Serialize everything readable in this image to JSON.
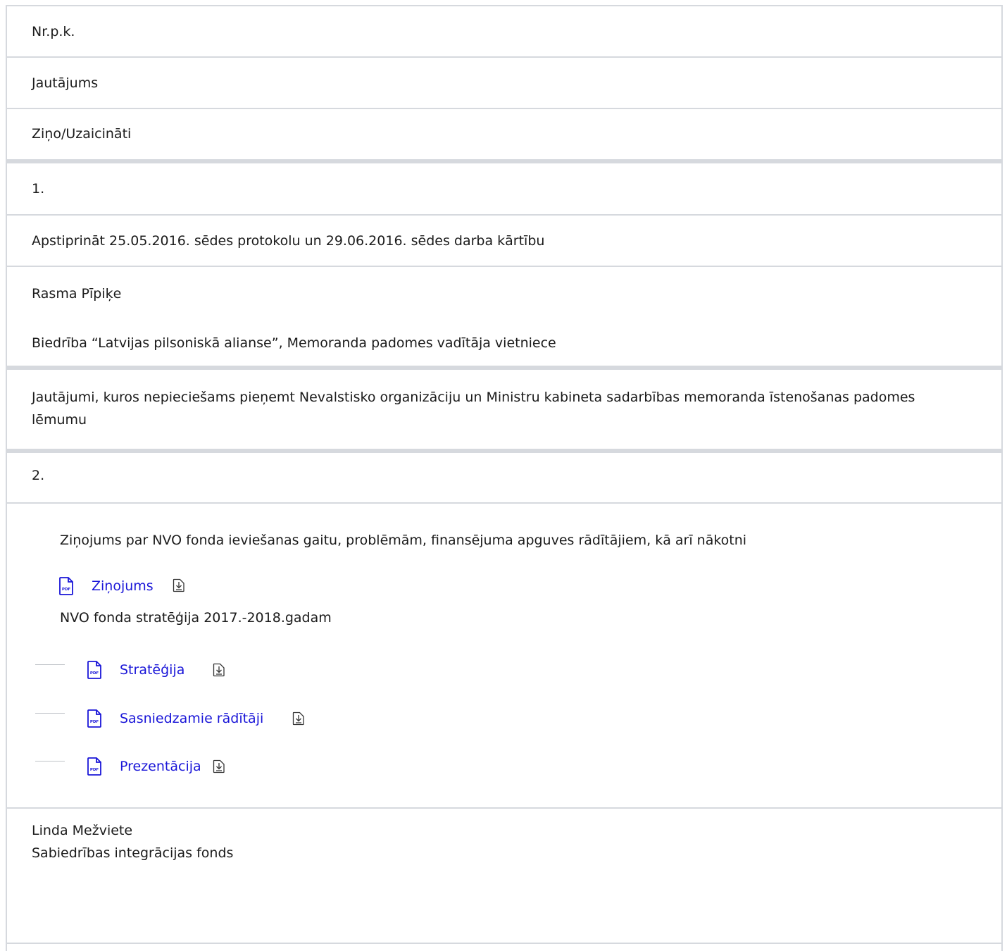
{
  "headers": {
    "nr": "Nr.p.k.",
    "question": "Jautājums",
    "presenter": "Ziņo/Uzaicināti"
  },
  "item1": {
    "nr": "1.",
    "question": "Apstiprināt 25.05.2016. sēdes protokolu un 29.06.2016. sēdes darba kārtību",
    "presenter_name": "Rasma Pīpiķe",
    "presenter_org": "Biedrība “Latvijas pilsoniskā alianse”, Memoranda padomes vadītāja vietniece"
  },
  "section": {
    "text": "Jautājumi, kuros nepieciešams pieņemt Nevalstisko organizāciju un Ministru kabineta sadarbības memoranda īstenošanas padomes lēmumu"
  },
  "item2": {
    "nr": "2.",
    "report_title": "Ziņojums par NVO fonda ieviešanas gaitu, problēmām, finansējuma apguves rādītājiem, kā arī nākotni",
    "report_link": "Ziņojums",
    "strategy_title": "NVO fonda stratēģija 2017.-2018.gadam",
    "links": [
      {
        "label": "Stratēģija"
      },
      {
        "label": "Sasniedzamie rādītāji"
      },
      {
        "label": "Prezentācija"
      }
    ],
    "presenter_name": "Linda Mežviete",
    "presenter_org": "Sabiedrības integrācijas fonds"
  },
  "icons": {
    "pdf": "pdf-file-icon",
    "download": "download-icon"
  },
  "colors": {
    "link": "#1a16d8",
    "border": "#d6d9de",
    "text": "#1b1b1b"
  }
}
